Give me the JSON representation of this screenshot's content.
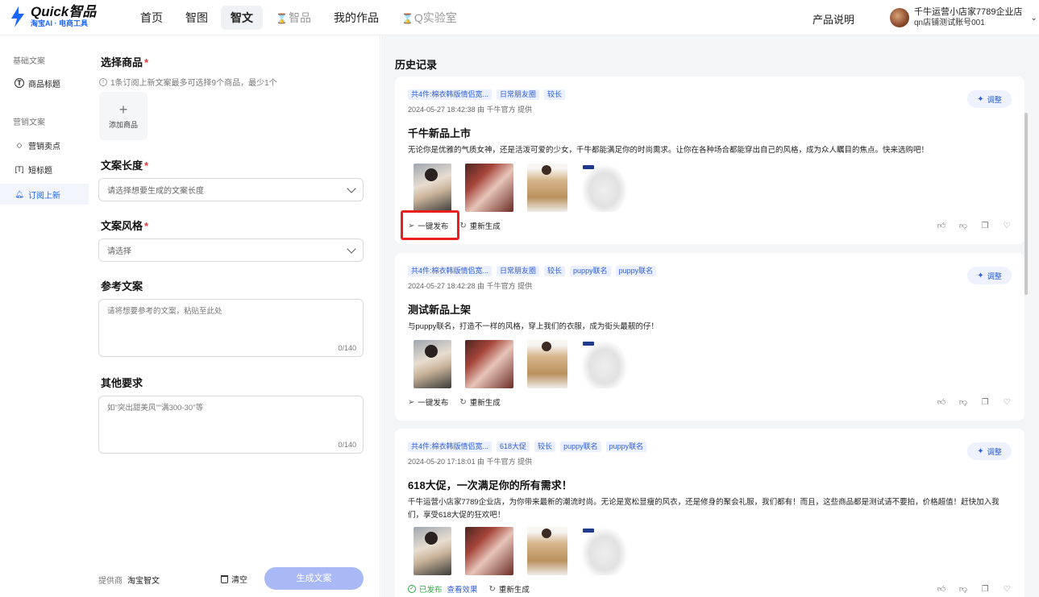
{
  "brand": {
    "title": "Quick智品",
    "subtitle": "淘宝AI · 电商工具",
    "accent": "#1a66ff"
  },
  "nav": [
    {
      "label": "首页",
      "state": "normal"
    },
    {
      "label": "智图",
      "state": "normal"
    },
    {
      "label": "智文",
      "state": "active"
    },
    {
      "label": "智品",
      "state": "disabled"
    },
    {
      "label": "我的作品",
      "state": "normal"
    },
    {
      "label": "Q实验室",
      "state": "disabled"
    }
  ],
  "header": {
    "product_doc": "产品说明",
    "user_name": "千牛运营小店家7789企业店",
    "user_account": "qn店铺测试账号001"
  },
  "sidebar": {
    "group_basic": "基础文案",
    "group_marketing": "营销文案",
    "items": [
      {
        "label": "商品标题",
        "icon": "title-icon"
      },
      {
        "label": "营销卖点",
        "icon": "diamond-icon"
      },
      {
        "label": "短标题",
        "icon": "short-title-icon"
      },
      {
        "label": "订阅上新",
        "icon": "bell-icon"
      }
    ]
  },
  "form": {
    "goods_label": "选择商品",
    "goods_hint": "1条订阅上新文案最多可选择9个商品，最少1个",
    "add_goods": "添加商品",
    "length_label": "文案长度",
    "length_placeholder": "请选择想要生成的文案长度",
    "style_label": "文案风格",
    "style_placeholder": "请选择",
    "ref_label": "参考文案",
    "ref_placeholder": "请将想要参考的文案，粘贴至此处",
    "ref_count": "0/140",
    "other_label": "其他要求",
    "other_placeholder": "如\"突出甜美风\"\"满300-30\"等",
    "other_count": "0/140",
    "provider_label": "提供商",
    "provider_value": "淘宝智文",
    "clear": "清空",
    "generate": "生成文案"
  },
  "history": {
    "title": "历史记录",
    "adjust": "调整",
    "publish": "一键发布",
    "regenerate": "重新生成",
    "published": "已发布",
    "view_effect": "查看效果",
    "cards": [
      {
        "tags": [
          "共4件:棉衣韩版情侣宽...",
          "日常朋友圈",
          "较长"
        ],
        "meta": "2024-05-27 18:42:38 由 千牛官方 提供",
        "title": "千牛新品上市",
        "body": "无论你是优雅的气质女神，还是活泼可爱的少女，千牛都能满足你的时尚需求。让你在各种场合都能穿出自己的风格，成为众人瞩目的焦点。快来选购吧！",
        "status": "unpublished"
      },
      {
        "tags": [
          "共4件:棉衣韩版情侣宽...",
          "日常朋友圈",
          "较长",
          "puppy联名",
          "puppy联名"
        ],
        "meta": "2024-05-27 18:42:28 由 千牛官方 提供",
        "title": "测试新品上架",
        "body": "与puppy联名，打造不一样的风格，穿上我们的衣服，成为街头最靓的仔！",
        "status": "unpublished"
      },
      {
        "tags": [
          "共4件:棉衣韩版情侣宽...",
          "618大促",
          "较长",
          "puppy联名",
          "puppy联名"
        ],
        "meta": "2024-05-20 17:18:01 由 千牛官方 提供",
        "title": "618大促，一次满足你的所有需求！",
        "body": "千牛运营小店家7789企业店，为你带来最新的潮流时尚。无论是宽松显瘦的风衣，还是修身的聚会礼服，我们都有！而且，这些商品都是测试请不要拍，价格超值！赶快加入我们，享受618大促的狂欢吧！",
        "status": "published"
      }
    ]
  }
}
